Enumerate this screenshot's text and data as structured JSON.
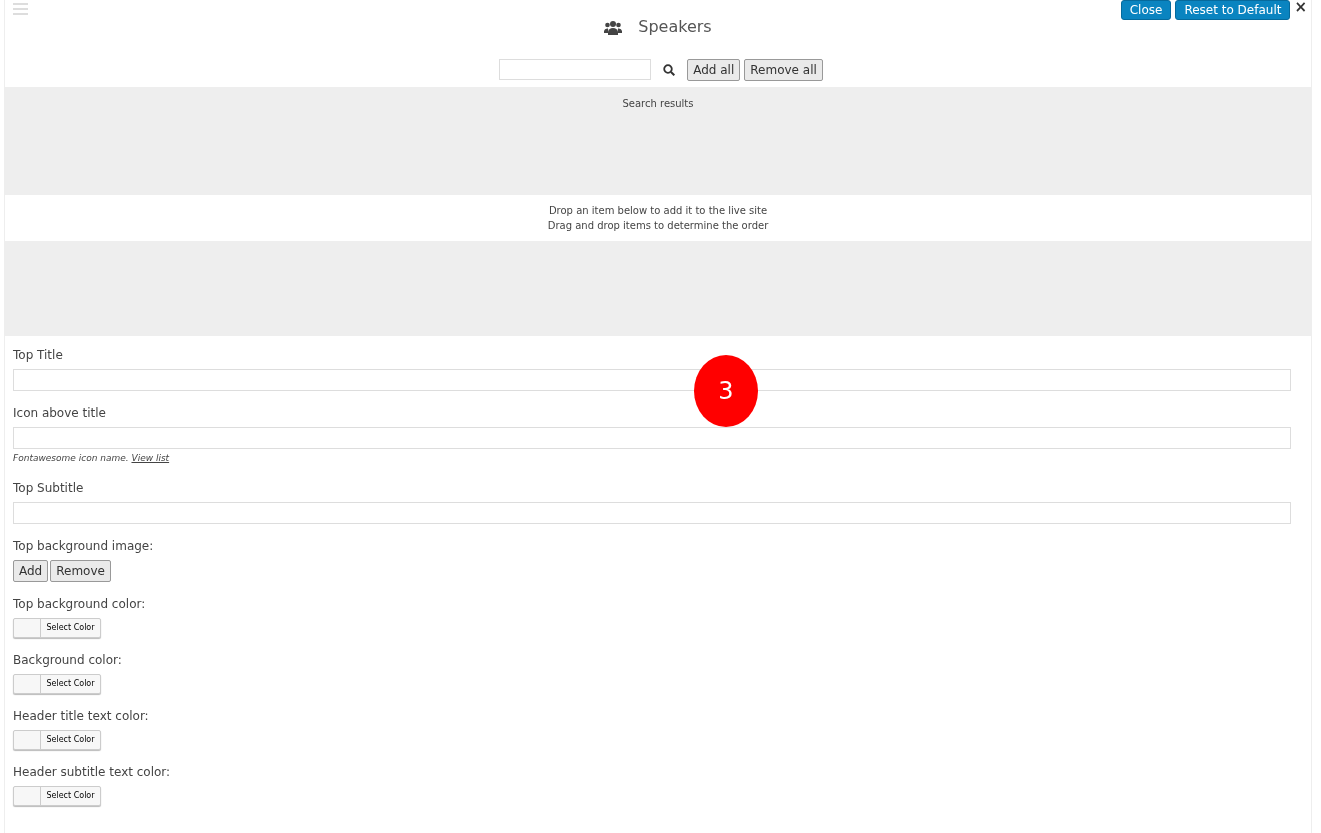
{
  "header": {
    "title": "Speakers",
    "buttons": [
      "Close",
      "Reset to Default"
    ],
    "close_glyph": "×"
  },
  "search": {
    "buttons": [
      "Add all",
      "Remove all"
    ]
  },
  "results": {
    "label": "Search results"
  },
  "drop_hint": [
    "Drop an item below to add it to the live site",
    "Drag and drop items to determine the order"
  ],
  "fields": [
    {
      "kind": "text",
      "label": "Top Title"
    },
    {
      "kind": "text",
      "label": "Icon above title",
      "help": "Fontawesome icon name.",
      "help_link": "View list"
    },
    {
      "kind": "text",
      "label": "Top Subtitle"
    },
    {
      "kind": "image",
      "label": "Top background image:",
      "buttons": [
        "Add",
        "Remove"
      ]
    },
    {
      "kind": "color",
      "label": "Top background color:",
      "button": "Select Color"
    },
    {
      "kind": "color",
      "label": "Background color:",
      "button": "Select Color"
    },
    {
      "kind": "color",
      "label": "Header title text color:",
      "button": "Select Color"
    },
    {
      "kind": "color",
      "label": "Header subtitle text color:",
      "button": "Select Color"
    }
  ],
  "callout": {
    "number": "3"
  }
}
